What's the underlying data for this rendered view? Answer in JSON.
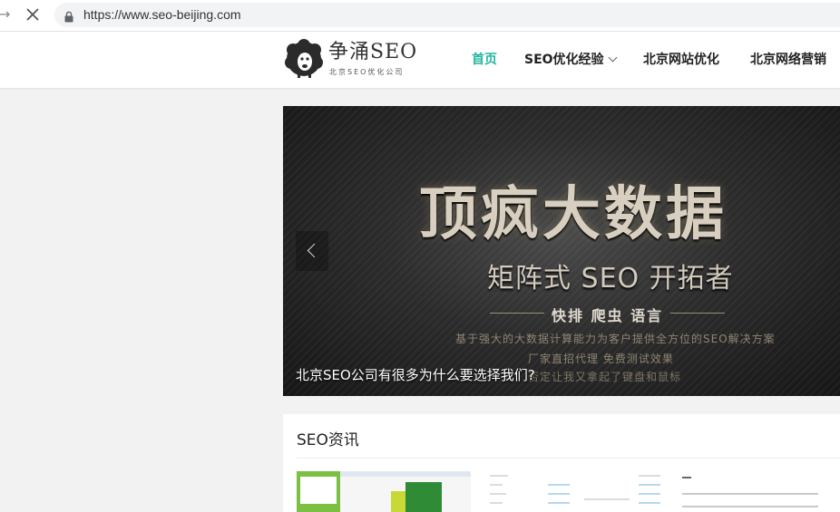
{
  "browser": {
    "url": "https://www.seo-beijing.com",
    "forward_icon": "arrow-right-icon",
    "stop_icon": "close-icon",
    "lock_icon": "lock-icon"
  },
  "site": {
    "logo_title": "争涌SEO",
    "logo_subtitle": "北京SEO优化公司",
    "nav": [
      {
        "label": "首页",
        "active": true
      },
      {
        "label": "SEO优化经验",
        "has_dropdown": true
      },
      {
        "label": "北京网站优化"
      },
      {
        "label": "北京网络营销"
      }
    ],
    "accent_color": "#23b5a0"
  },
  "banner": {
    "headline": "顶疯大数据",
    "subheadline": "矩阵式 SEO 开拓者",
    "tags": "快排 爬虫 语言",
    "desc_line1": "基于强大的大数据计算能力为客户提供全方位的SEO解决方案",
    "desc_line2": "厂家直招代理 免费测试效果",
    "desc_line3": "否定让我又拿起了键盘和鼠标",
    "caption": "北京SEO公司有很多为什么要选择我们?",
    "prev_icon": "chevron-left-icon"
  },
  "news": {
    "title": "SEO资讯"
  }
}
